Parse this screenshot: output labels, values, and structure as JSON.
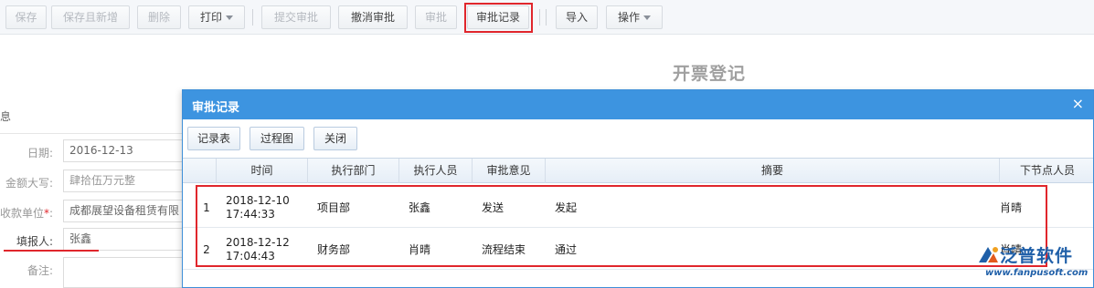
{
  "toolbar": {
    "buttons": [
      {
        "label": "保存"
      },
      {
        "label": "保存且新增"
      },
      {
        "label": "删除"
      },
      {
        "label": "打印"
      },
      {
        "label": "提交审批"
      },
      {
        "label": "撤消审批"
      },
      {
        "label": "审批"
      },
      {
        "label": "审批记录"
      },
      {
        "label": "导入"
      },
      {
        "label": "操作"
      }
    ]
  },
  "form": {
    "title": "开票登记",
    "section": "息",
    "fields": [
      {
        "label": "日期:",
        "value": "2016-12-13"
      },
      {
        "label": "金额大写:",
        "value": "肆拾伍万元整"
      },
      {
        "label": "收款单位",
        "value": "成都展望设备租赁有限"
      },
      {
        "label": "填报人:",
        "value": "张鑫"
      },
      {
        "label": "备注:",
        "value": ""
      }
    ]
  },
  "modal": {
    "title": "审批记录",
    "close": "×",
    "buttons": [
      {
        "label": "记录表"
      },
      {
        "label": "过程图"
      },
      {
        "label": "关闭"
      }
    ],
    "columns": [
      "时间",
      "执行部门",
      "执行人员",
      "审批意见",
      "摘要",
      "下节点人员"
    ],
    "rows": [
      {
        "idx": "1",
        "time": "2018-12-10\n17:44:33",
        "dept": "项目部",
        "person": "张鑫",
        "opinion": "发送",
        "summary": "发起",
        "next": "肖晴"
      },
      {
        "idx": "2",
        "time": "2018-12-12\n17:04:43",
        "dept": "财务部",
        "person": "肖晴",
        "opinion": "流程结束",
        "summary": "通过",
        "next": "肖晴"
      }
    ]
  },
  "watermark": {
    "name": "泛普软件",
    "url": "www.fanpusoft.com"
  }
}
